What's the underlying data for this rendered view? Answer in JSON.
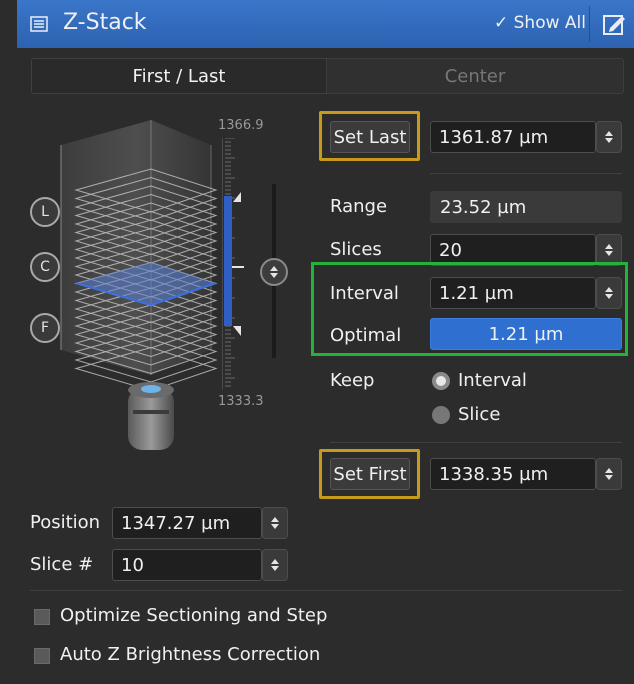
{
  "header": {
    "title": "Z-Stack",
    "show_all": "Show All"
  },
  "tabs": [
    {
      "label": "First / Last",
      "active": true
    },
    {
      "label": "Center",
      "active": false
    }
  ],
  "scale": {
    "top": "1366.9",
    "bottom": "1333.3"
  },
  "markers": {
    "last": "L",
    "center": "C",
    "first": "F"
  },
  "set_last": {
    "button": "Set Last",
    "value": "1361.87 µm"
  },
  "range": {
    "label": "Range",
    "value": "23.52 µm"
  },
  "slices": {
    "label": "Slices",
    "value": "20"
  },
  "interval": {
    "label": "Interval",
    "value": "1.21 µm"
  },
  "optimal": {
    "label": "Optimal",
    "value": "1.21 µm"
  },
  "keep": {
    "label": "Keep",
    "options": [
      {
        "label": "Interval",
        "selected": true
      },
      {
        "label": "Slice",
        "selected": false
      }
    ]
  },
  "set_first": {
    "button": "Set First",
    "value": "1338.35 µm"
  },
  "position": {
    "label": "Position",
    "value": "1347.27 µm"
  },
  "slice_num": {
    "label": "Slice #",
    "value": "10"
  },
  "options": [
    {
      "label": "Optimize Sectioning and Step",
      "checked": false
    },
    {
      "label": "Auto Z Brightness Correction",
      "checked": false
    }
  ],
  "colors": {
    "accent": "#2d62b1",
    "optimal_btn": "#2e6fd0",
    "highlight_gold": "#c89a1b",
    "highlight_green": "#23b33a"
  }
}
